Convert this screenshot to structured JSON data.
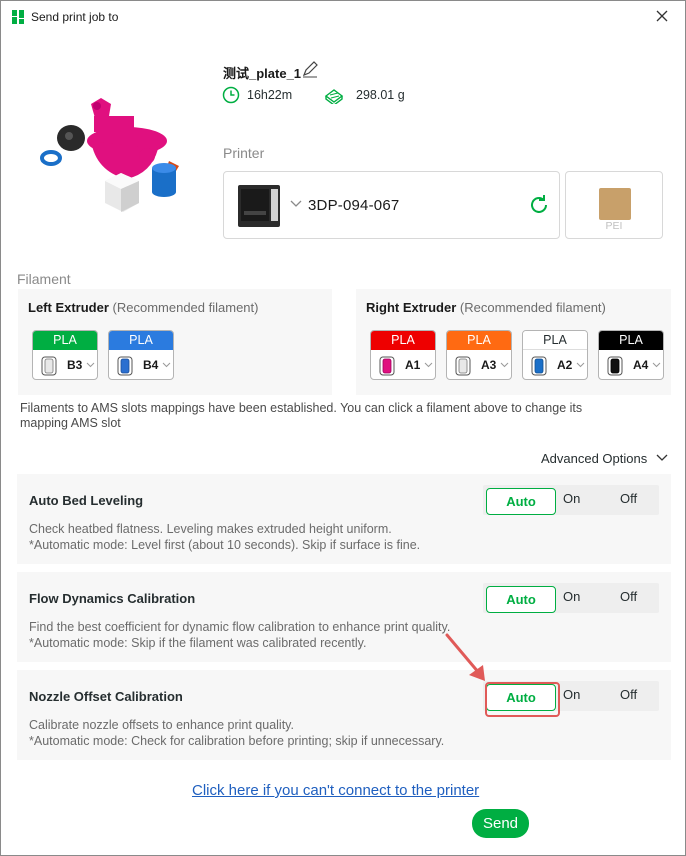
{
  "window": {
    "title": "Send print job to"
  },
  "job": {
    "name": "测试_plate_1",
    "time": "16h22m",
    "weight": "298.01 g"
  },
  "printer": {
    "label": "Printer",
    "name": "3DP-094-067",
    "plate_label": "PEI"
  },
  "filament": {
    "section_label": "Filament",
    "left": {
      "title": "Left Extruder",
      "subtitle": "(Recommended filament)",
      "slots": [
        {
          "type": "PLA",
          "id": "B3",
          "header_color": "#00ae42",
          "spool_color": "#e8e8e8"
        },
        {
          "type": "PLA",
          "id": "B4",
          "header_color": "#2b7bdf",
          "spool_color": "#2b6fd0"
        }
      ]
    },
    "right": {
      "title": "Right Extruder",
      "subtitle": "(Recommended filament)",
      "slots": [
        {
          "type": "PLA",
          "id": "A1",
          "header_color": "#ee0000",
          "spool_color": "#e0107f"
        },
        {
          "type": "PLA",
          "id": "A3",
          "header_color": "#ff6a12",
          "spool_color": "#e8e8e8"
        },
        {
          "type": "PLA",
          "id": "A2",
          "header_color": "#ffffff",
          "spool_color": "#1a6fc8"
        },
        {
          "type": "PLA",
          "id": "A4",
          "header_color": "#000000",
          "spool_color": "#111111"
        }
      ]
    },
    "note": "Filaments to AMS slots mappings have been established. You can click a filament above to change its mapping AMS slot"
  },
  "advanced": {
    "label": "Advanced Options",
    "options": [
      {
        "title": "Auto Bed Leveling",
        "desc_line1": "Check heatbed flatness. Leveling makes extruded height uniform.",
        "desc_line2": "*Automatic mode: Level first (about 10 seconds). Skip if surface is fine.",
        "auto": "Auto",
        "on": "On",
        "off": "Off",
        "selected": "Auto"
      },
      {
        "title": "Flow Dynamics Calibration",
        "desc_line1": "Find the best coefficient for dynamic flow calibration to enhance print quality.",
        "desc_line2": "*Automatic mode: Skip if the filament was calibrated recently.",
        "auto": "Auto",
        "on": "On",
        "off": "Off",
        "selected": "Auto"
      },
      {
        "title": "Nozzle Offset Calibration",
        "desc_line1": "Calibrate nozzle offsets to enhance print quality.",
        "desc_line2": "*Automatic mode: Check for calibration before printing; skip if unnecessary.",
        "auto": "Auto",
        "on": "On",
        "off": "Off",
        "selected": "Auto"
      }
    ]
  },
  "footer": {
    "link_text": "Click here if you can't connect to the printer",
    "send_label": "Send"
  },
  "colors": {
    "accent": "#00ae42",
    "link": "#1f5fbf",
    "highlight": "#e05a58"
  },
  "icons": [
    "app-logo-icon",
    "close-icon",
    "edit-icon",
    "clock-icon",
    "filament-weight-icon",
    "chevron-down-icon",
    "refresh-icon",
    "spool-icon"
  ]
}
